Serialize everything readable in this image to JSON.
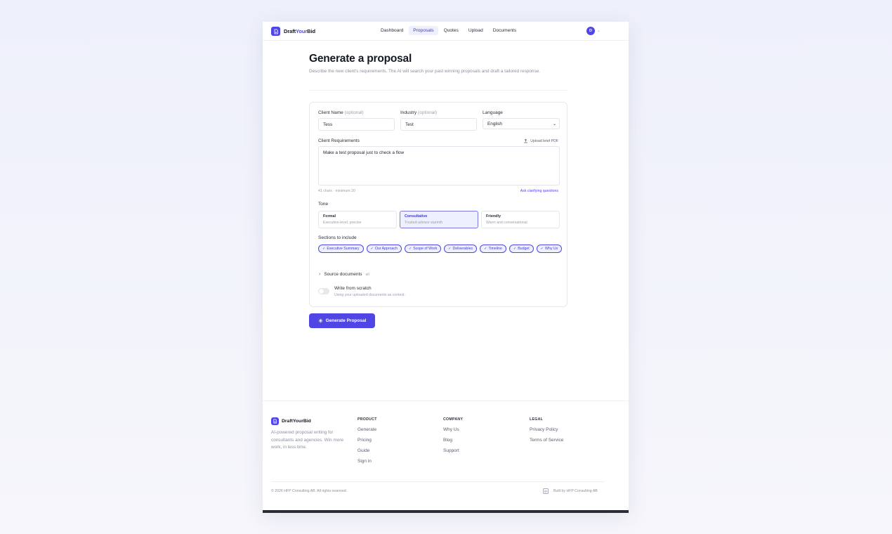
{
  "nav": {
    "brand_prefix": "Draft",
    "brand_accent": "Your",
    "brand_suffix": "Bid",
    "links": [
      "Dashboard",
      "Proposals",
      "Quotes",
      "Upload",
      "Documents"
    ],
    "active_link": "Proposals",
    "avatar_initial": "D"
  },
  "header": {
    "title": "Generate a proposal",
    "subtitle": "Describe the new client's requirements. The AI will search your past winning proposals and draft a tailored response."
  },
  "form": {
    "client_name_label": "Client Name",
    "client_name_optional": "(optional)",
    "client_name_value": "Tess",
    "industry_label": "Industry",
    "industry_optional": "(optional)",
    "industry_value": "Test",
    "language_label": "Language",
    "language_value": "English",
    "requirements_label": "Client Requirements",
    "upload_label": "Upload brief PDF",
    "requirements_value": "Make a test proposal just to check a flow",
    "char_count": "41 chars · minimum 20",
    "ask_link": "Ask clarifying questions",
    "tone_label": "Tone",
    "tones": [
      {
        "name": "Formal",
        "desc": "Executive-level, precise"
      },
      {
        "name": "Consultative",
        "desc": "Trusted-advisor warmth"
      },
      {
        "name": "Friendly",
        "desc": "Warm and conversational"
      }
    ],
    "selected_tone": "Consultative",
    "sections_label": "Sections to include",
    "sections": [
      "Executive Summary",
      "Our Approach",
      "Scope of Work",
      "Deliverables",
      "Timeline",
      "Budget",
      "Why Us"
    ],
    "source_label": "Source documents",
    "source_count": "all",
    "scratch_title": "Write from scratch",
    "scratch_desc": "Using your uploaded documents as context.",
    "scratch_enabled": false,
    "generate_label": "Generate Proposal"
  },
  "footer": {
    "brand": "DraftYourBid",
    "description": "AI-powered proposal writing for consultants and agencies. Win more work, in less time.",
    "columns": [
      {
        "heading": "PRODUCT",
        "items": [
          "Generate",
          "Pricing",
          "Guide",
          "Sign in"
        ]
      },
      {
        "heading": "COMPANY",
        "items": [
          "Why Us",
          "Blog",
          "Support"
        ]
      },
      {
        "heading": "LEGAL",
        "items": [
          "Privacy Policy",
          "Terms of Service"
        ]
      }
    ],
    "copyright": "© 2026 HFP Consulting AB. All rights reserved.",
    "built_by": "Built by HFP Consulting AB"
  },
  "colors": {
    "accent": "#4f46e5",
    "accent_soft": "#eef0fd",
    "text": "#1f2430",
    "muted": "#8a90a0"
  }
}
